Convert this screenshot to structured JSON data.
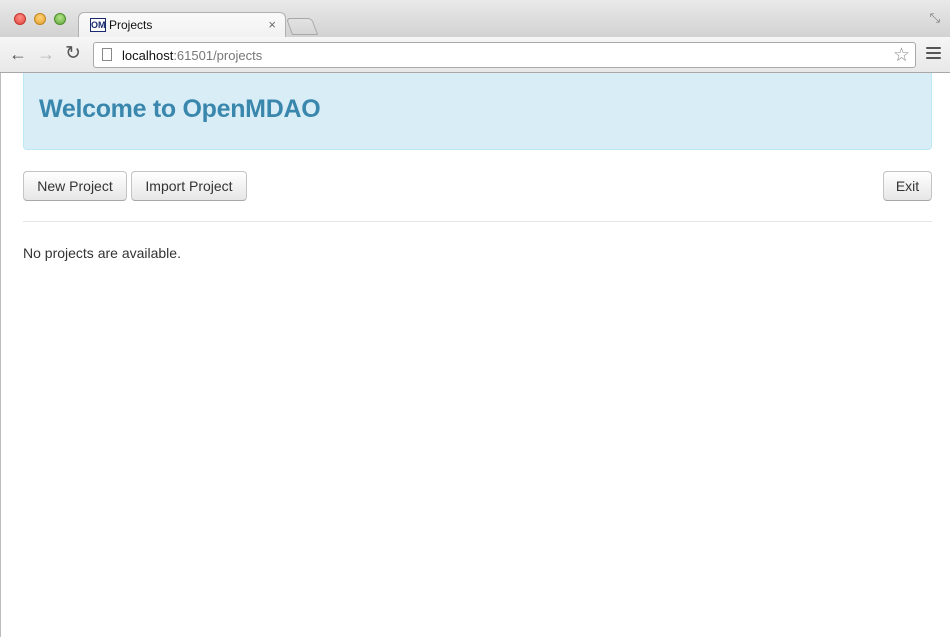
{
  "browser": {
    "tab_title": "Projects",
    "favicon_text": "OM",
    "tab_close": "×",
    "url_host": "localhost",
    "url_rest": ":61501/projects",
    "icons": {
      "back": "←",
      "forward": "→",
      "reload": "↻",
      "star": "☆",
      "restore": "⤡"
    }
  },
  "page": {
    "heading": "Welcome to OpenMDAO",
    "buttons": {
      "new_project": "New Project",
      "import_project": "Import Project",
      "exit": "Exit"
    },
    "empty_message": "No projects are available."
  },
  "colors": {
    "hero_background": "#d9edf7",
    "hero_text": "#3a87ad"
  }
}
